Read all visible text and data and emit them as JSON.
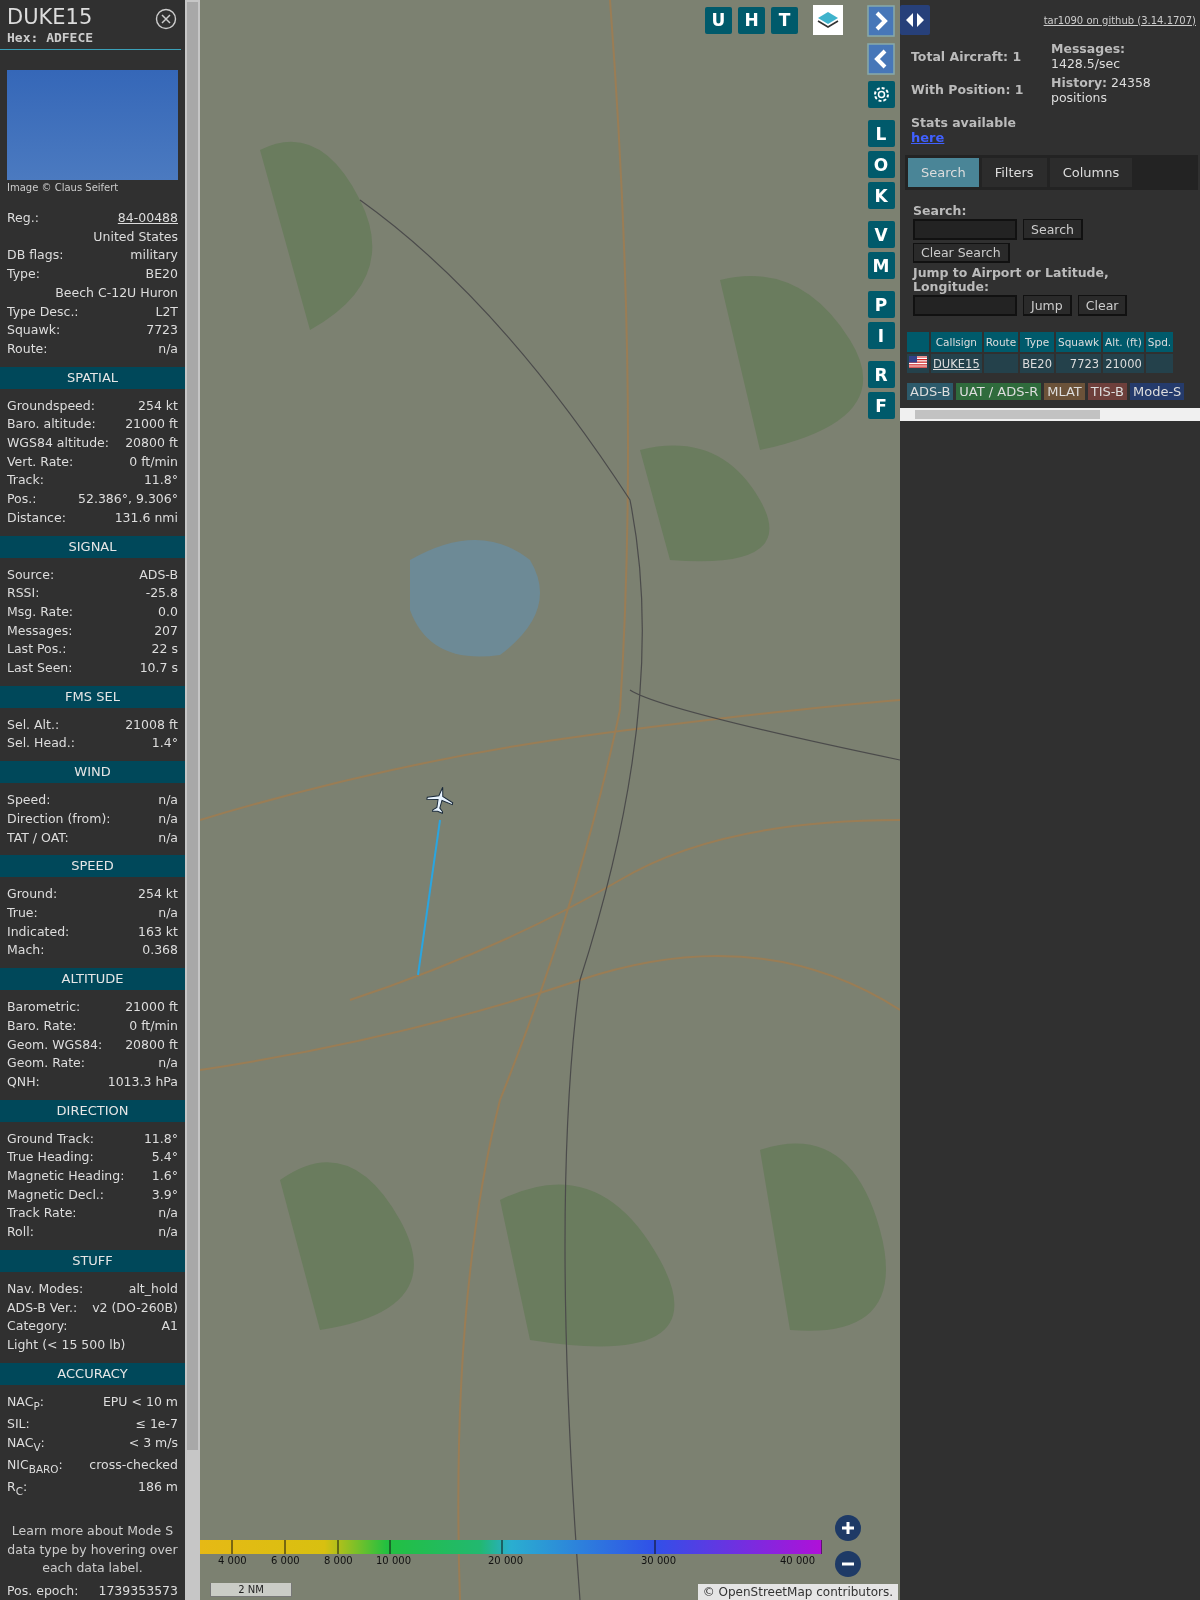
{
  "detail": {
    "callsign": "DUKE15",
    "hex": "Hex: ADFECE",
    "photo_credit": "Image © Claus Seifert",
    "rows": [
      {
        "kind": "link",
        "label": "Reg.:",
        "value": "84-00488"
      },
      {
        "kind": "value",
        "value": "United States"
      },
      {
        "kind": "pair",
        "label": "DB flags:",
        "value": "military"
      },
      {
        "kind": "pair",
        "label": "Type:",
        "value": "BE20"
      },
      {
        "kind": "value",
        "value": "Beech C-12U Huron"
      },
      {
        "kind": "pair",
        "label": "Type Desc.:",
        "value": "L2T"
      },
      {
        "kind": "pair",
        "label": "Squawk:",
        "value": "7723"
      },
      {
        "kind": "pair",
        "label": "Route:",
        "value": "n/a"
      }
    ],
    "sections": [
      {
        "title": "SPATIAL",
        "rows": [
          {
            "kind": "pair",
            "label": "Groundspeed:",
            "value": "254 kt"
          },
          {
            "kind": "pair",
            "label": "Baro. altitude:",
            "value": "21000 ft"
          },
          {
            "kind": "pair",
            "label": "WGS84 altitude:",
            "value": "20800 ft"
          },
          {
            "kind": "pair",
            "label": "Vert. Rate:",
            "value": "0 ft/min"
          },
          {
            "kind": "pair",
            "label": "Track:",
            "value": "11.8°"
          },
          {
            "kind": "pair",
            "label": "Pos.:",
            "value": "52.386°, 9.306°"
          },
          {
            "kind": "pair",
            "label": "Distance:",
            "value": "131.6 nmi"
          }
        ]
      },
      {
        "title": "SIGNAL",
        "rows": [
          {
            "kind": "pair",
            "label": "Source:",
            "value": "ADS-B"
          },
          {
            "kind": "pair",
            "label": "RSSI:",
            "value": "-25.8"
          },
          {
            "kind": "pair",
            "label": "Msg. Rate:",
            "value": "0.0"
          },
          {
            "kind": "pair",
            "label": "Messages:",
            "value": "207"
          },
          {
            "kind": "pair",
            "label": "Last Pos.:",
            "value": "22 s"
          },
          {
            "kind": "pair",
            "label": "Last Seen:",
            "value": "10.7 s"
          }
        ]
      },
      {
        "title": "FMS SEL",
        "rows": [
          {
            "kind": "pair",
            "label": "Sel. Alt.:",
            "value": "21008 ft"
          },
          {
            "kind": "pair",
            "label": "Sel. Head.:",
            "value": "1.4°"
          }
        ]
      },
      {
        "title": "WIND",
        "rows": [
          {
            "kind": "pair",
            "label": "Speed:",
            "value": "n/a"
          },
          {
            "kind": "pair",
            "label": "Direction (from):",
            "value": "n/a"
          },
          {
            "kind": "pair",
            "label": "TAT / OAT:",
            "value": "n/a"
          }
        ]
      },
      {
        "title": "SPEED",
        "rows": [
          {
            "kind": "pair",
            "label": "Ground:",
            "value": "254 kt"
          },
          {
            "kind": "pair",
            "label": "True:",
            "value": "n/a"
          },
          {
            "kind": "pair",
            "label": "Indicated:",
            "value": "163 kt"
          },
          {
            "kind": "pair",
            "label": "Mach:",
            "value": "0.368"
          }
        ]
      },
      {
        "title": "ALTITUDE",
        "rows": [
          {
            "kind": "pair",
            "label": "Barometric:",
            "value": "21000 ft"
          },
          {
            "kind": "pair",
            "label": "Baro. Rate:",
            "value": "0 ft/min"
          },
          {
            "kind": "pair",
            "label": "Geom. WGS84:",
            "value": "20800 ft"
          },
          {
            "kind": "pair",
            "label": "Geom. Rate:",
            "value": "n/a"
          },
          {
            "kind": "pair",
            "label": "QNH:",
            "value": "1013.3 hPa"
          }
        ]
      },
      {
        "title": "DIRECTION",
        "rows": [
          {
            "kind": "pair",
            "label": "Ground Track:",
            "value": "11.8°"
          },
          {
            "kind": "pair",
            "label": "True Heading:",
            "value": "5.4°"
          },
          {
            "kind": "pair",
            "label": "Magnetic Heading:",
            "value": "1.6°"
          },
          {
            "kind": "pair",
            "label": "Magnetic Decl.:",
            "value": "3.9°"
          },
          {
            "kind": "pair",
            "label": "Track Rate:",
            "value": "n/a"
          },
          {
            "kind": "pair",
            "label": "Roll:",
            "value": "n/a"
          }
        ]
      },
      {
        "title": "STUFF",
        "rows": [
          {
            "kind": "pair",
            "label": "Nav. Modes:",
            "value": "alt_hold"
          },
          {
            "kind": "pair",
            "label": "ADS-B Ver.:",
            "value": "v2 (DO-260B)"
          },
          {
            "kind": "pair",
            "label": "Category:",
            "value": "A1"
          },
          {
            "kind": "label",
            "label": "Light (< 15 500 lb)"
          }
        ]
      },
      {
        "title": "ACCURACY",
        "rows": [
          {
            "kind": "pair",
            "label": "NAC$_{P}$:",
            "value": "EPU < 10 m"
          },
          {
            "kind": "pair",
            "label": "SIL:",
            "value": "≤ 1e-7"
          },
          {
            "kind": "pair",
            "label": "NAC$_{V}$:",
            "value": "< 3 m/s"
          },
          {
            "kind": "pair",
            "label": "NIC$_{BARO}$:",
            "value": "cross-checked"
          },
          {
            "kind": "pair",
            "label": "R$_{C}$:",
            "value": "186 m"
          }
        ]
      }
    ],
    "note": "Learn more about Mode S data type by hovering over each data label.",
    "epoch": {
      "label": "Pos. epoch:",
      "value": "1739353573"
    }
  },
  "toolbar": {
    "top_buttons": [
      "U",
      "H",
      "T"
    ],
    "side_groups": [
      [
        "L",
        "O",
        "K"
      ],
      [
        "V",
        "M"
      ],
      [
        "P",
        "I"
      ],
      [
        "R",
        "F"
      ]
    ]
  },
  "map": {
    "altitude_ticks": [
      "4 000",
      "6 000",
      "8 000",
      "10 000",
      "20 000",
      "30 000",
      "40 000"
    ],
    "scale": "2 NM",
    "attribution": "© OpenStreetMap contributors."
  },
  "panel": {
    "github_link": "tar1090 on github (3.14.1707)",
    "counts": [
      "Total Aircraft: 1",
      "With Position: 1"
    ],
    "rates": [
      "**Messages:** 1428.5/sec",
      "**History:** 24358 positions"
    ],
    "stats_text": "Stats available",
    "stats_link": "here",
    "tabs": [
      {
        "label": "Search",
        "selected": true
      },
      {
        "label": "Filters",
        "selected": false
      },
      {
        "label": "Columns",
        "selected": false
      }
    ],
    "search": {
      "label": "Search:",
      "button": "Search",
      "clear_button": "Clear Search",
      "jump_label": "Jump to Airport or Latitude, Longitude:",
      "jump_button": "Jump",
      "clear_jump_button": "Clear"
    },
    "table": {
      "columns": [
        "Callsign",
        "Route",
        "Type",
        "Squawk",
        "Alt. (ft)",
        "Spd."
      ],
      "rows": [
        {
          "callsign": "DUKE15",
          "type": "BE20",
          "squawk": "7723",
          "altitude": "21000"
        }
      ]
    },
    "legend": [
      {
        "label": "ADS-B",
        "color": "#2c5a6b"
      },
      {
        "label": "UAT / ADS-R",
        "color": "#2f6b3c"
      },
      {
        "label": "MLAT",
        "color": "#6b5239"
      },
      {
        "label": "TIS-B",
        "color": "#6e3f3b"
      },
      {
        "label": "Mode-S",
        "color": "#253b6c"
      }
    ]
  }
}
